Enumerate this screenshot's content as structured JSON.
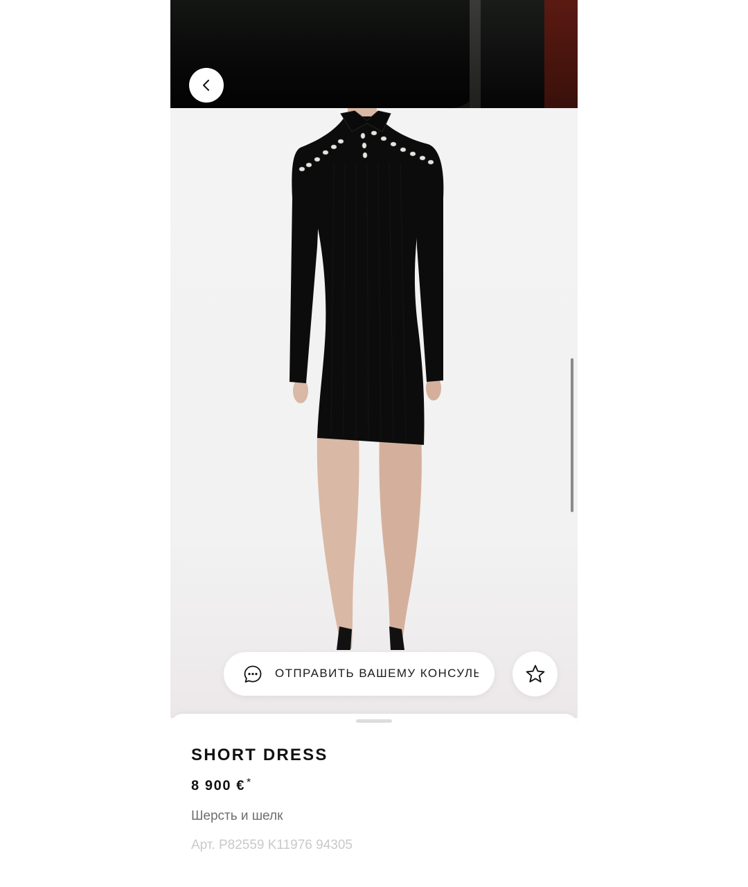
{
  "actions": {
    "send_label": "ОТПРАВИТЬ ВАШЕМУ КОНСУЛЬТАНТУ"
  },
  "product": {
    "title": "SHORT DRESS",
    "price": "8 900 €",
    "price_note": "*",
    "material": "Шерсть и шелк",
    "article": "Арт. P82559 K11976 94305"
  },
  "icons": {
    "back": "chevron-left-icon",
    "chat": "chat-bubble-icon",
    "favorite": "star-icon"
  },
  "colors": {
    "background": "#ffffff",
    "text_primary": "#111111",
    "text_secondary": "#6e6e6e",
    "text_muted": "#c9c9c9",
    "dress": "#0c0c0c"
  }
}
